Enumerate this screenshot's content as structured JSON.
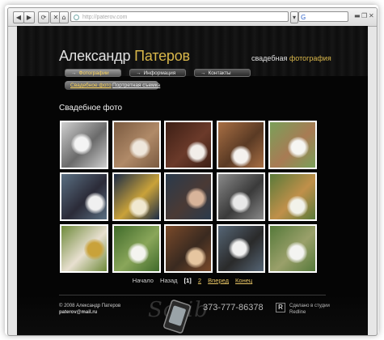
{
  "browser": {
    "nav_buttons": [
      "◀",
      "▶",
      "⟳",
      "✕",
      "⌂"
    ],
    "address_url": "http://paterov.com",
    "search_logo": "G"
  },
  "site": {
    "first_name": "Александр",
    "last_name": "Патеров",
    "tagline_a": "свадебная",
    "tagline_b": "фотография",
    "nav": [
      {
        "label": "Фотографии",
        "active": true
      },
      {
        "label": "Информация",
        "active": false
      },
      {
        "label": "Контакты",
        "active": false
      }
    ],
    "subnav": [
      {
        "label": "Свадебное фото",
        "active": true
      },
      {
        "label": "Портретная съемка",
        "active": false
      }
    ],
    "section_title": "Свадебное фото",
    "pagination": {
      "first": "Начало",
      "prev": "Назад",
      "current": "[1]",
      "page2": "2",
      "next": "Вперед",
      "last": "Конец"
    },
    "footer": {
      "copyright": "© 2008 Александр Патеров",
      "email": "paterov@mail.ru",
      "phone": "373-777-86378",
      "studio_line1": "Сделано в студии",
      "studio_line2": "Redline"
    }
  },
  "photos": [
    {
      "bg": "#cfcfcf",
      "hl": "#f4f4f4",
      "mid": "#6a6a6a"
    },
    {
      "bg": "#7a5a40",
      "hl": "#efe7dc",
      "mid": "#b08a68"
    },
    {
      "bg": "#3d1f15",
      "hl": "#f2eee9",
      "mid": "#6b3a2a"
    },
    {
      "bg": "#a86f44",
      "hl": "#f5f2ee",
      "mid": "#5a3a24"
    },
    {
      "bg": "#7aa05a",
      "hl": "#f6f6f2",
      "mid": "#a87b54"
    },
    {
      "bg": "#5a6f82",
      "hl": "#f0f0f0",
      "mid": "#2b2b38"
    },
    {
      "bg": "#1b2b46",
      "hl": "#f0e8d0",
      "mid": "#c9a23a"
    },
    {
      "bg": "#2a3a4c",
      "hl": "#d8b49a",
      "mid": "#4a3a35"
    },
    {
      "bg": "#8a8a8a",
      "hl": "#e8e8e8",
      "mid": "#3a3a3a"
    },
    {
      "bg": "#5a7a3a",
      "hl": "#f2f2ea",
      "mid": "#c0904a"
    },
    {
      "bg": "#6f8a3a",
      "hl": "#c9a23a",
      "mid": "#e8e0d0"
    },
    {
      "bg": "#3f6a2a",
      "hl": "#f4f4f0",
      "mid": "#8aa65a"
    },
    {
      "bg": "#7a4a2a",
      "hl": "#e6c6a0",
      "mid": "#3a2a20"
    },
    {
      "bg": "#566676",
      "hl": "#f1f1f1",
      "mid": "#2a2a2a"
    },
    {
      "bg": "#55793a",
      "hl": "#f4f4f2",
      "mid": "#9aa06a"
    }
  ]
}
